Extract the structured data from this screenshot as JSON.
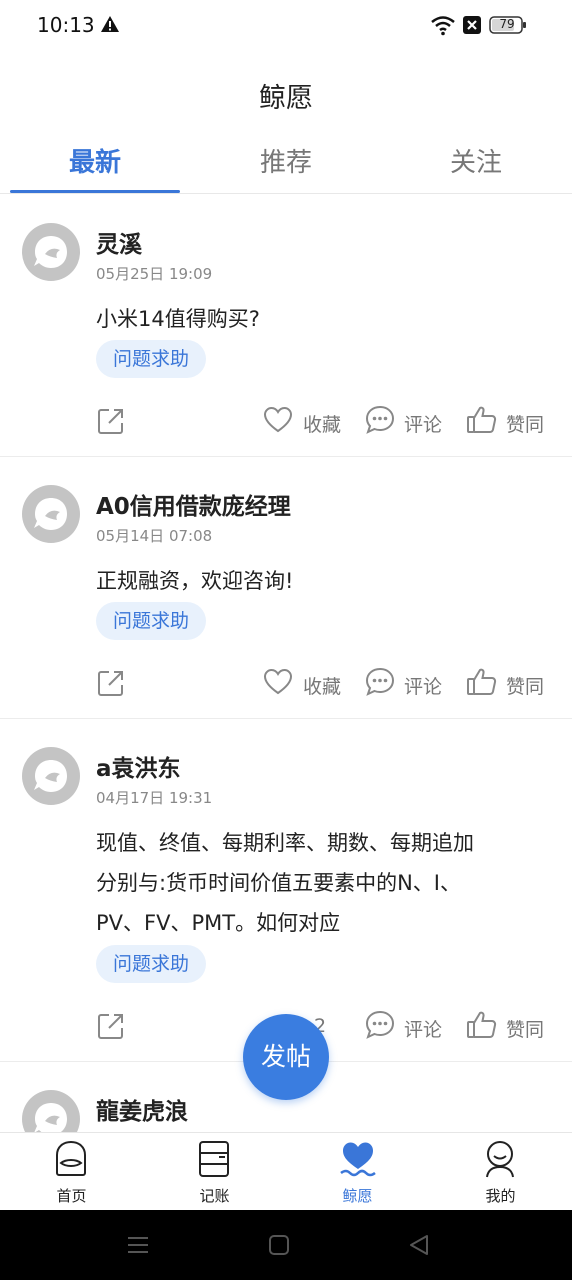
{
  "status_bar": {
    "time": "10:13",
    "battery": "79"
  },
  "header": {
    "title": "鲸愿"
  },
  "tabs": [
    {
      "label": "最新",
      "active": true
    },
    {
      "label": "推荐",
      "active": false
    },
    {
      "label": "关注",
      "active": false
    }
  ],
  "posts": [
    {
      "author": "灵溪",
      "date": "05月25日 19:09",
      "content": "小米14值得购买?",
      "tag": "问题求助",
      "favorite_label": "收藏",
      "comment_label": "评论",
      "like_label": "赞同"
    },
    {
      "author": "A0信用借款庞经理",
      "date": "05月14日 07:08",
      "content": "正规融资，欢迎咨询!",
      "tag": "问题求助",
      "favorite_label": "收藏",
      "comment_label": "评论",
      "like_label": "赞同"
    },
    {
      "author": "a袁洪东",
      "date": "04月17日 19:31",
      "content_lines": [
        "现值、终值、每期利率、期数、每期追加",
        "分别与:货币时间价值五要素中的N、I、",
        "PV、FV、PMT。如何对应"
      ],
      "tag": "问题求助",
      "favorite_count": "2",
      "comment_label": "评论",
      "like_label": "赞同"
    },
    {
      "author": "龍姜虎浪"
    }
  ],
  "fab": {
    "label": "发帖"
  },
  "bottom_nav": [
    {
      "label": "首页",
      "icon": "home-icon",
      "active": false
    },
    {
      "label": "记账",
      "icon": "ledger-icon",
      "active": false
    },
    {
      "label": "鲸愿",
      "icon": "whale-heart-icon",
      "active": true
    },
    {
      "label": "我的",
      "icon": "profile-icon",
      "active": false
    }
  ],
  "colors": {
    "accent": "#3a76d8",
    "fab": "#3a7de0",
    "tag_bg": "#e8f1fc",
    "avatar": "#c4c4c4"
  }
}
